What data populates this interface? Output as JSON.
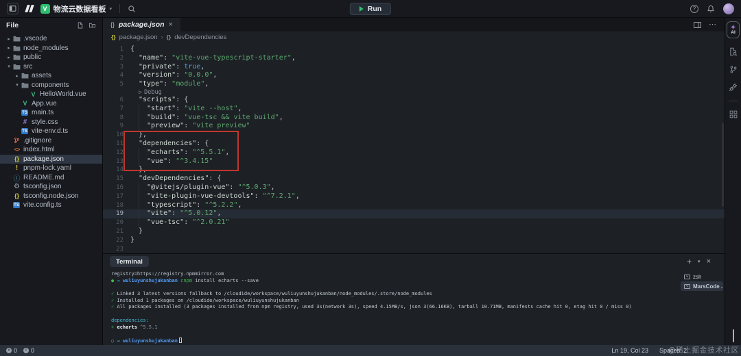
{
  "colors": {
    "accent_green": "#2fbf71",
    "annotation_red": "#c2362b",
    "ts_blue": "#3178c6",
    "json_yellow": "#cbcb41"
  },
  "titlebar": {
    "project_name": "物流云数据看板",
    "run_label": "Run"
  },
  "explorer": {
    "header": "File",
    "items": [
      {
        "depth": 0,
        "chevron": "closed",
        "icon": "folder",
        "label": ".vscode"
      },
      {
        "depth": 0,
        "chevron": "closed",
        "icon": "folder",
        "label": "node_modules"
      },
      {
        "depth": 0,
        "chevron": "closed",
        "icon": "folder",
        "label": "public"
      },
      {
        "depth": 0,
        "chevron": "open",
        "icon": "folder",
        "label": "src"
      },
      {
        "depth": 1,
        "chevron": "closed",
        "icon": "folder",
        "label": "assets"
      },
      {
        "depth": 1,
        "chevron": "open",
        "icon": "folder",
        "label": "components"
      },
      {
        "depth": 2,
        "icon": "vue",
        "label": "HelloWorld.vue"
      },
      {
        "depth": 1,
        "icon": "vue",
        "label": "App.vue"
      },
      {
        "depth": 1,
        "icon": "ts",
        "label": "main.ts"
      },
      {
        "depth": 1,
        "icon": "css",
        "label": "style.css"
      },
      {
        "depth": 1,
        "icon": "ts",
        "label": "vite-env.d.ts"
      },
      {
        "depth": 0,
        "icon": "git",
        "label": ".gitignore"
      },
      {
        "depth": 0,
        "icon": "html",
        "label": "index.html"
      },
      {
        "depth": 0,
        "icon": "json",
        "label": "package.json",
        "selected": true
      },
      {
        "depth": 0,
        "icon": "yaml",
        "label": "pnpm-lock.yaml"
      },
      {
        "depth": 0,
        "icon": "md",
        "label": "README.md"
      },
      {
        "depth": 0,
        "icon": "gear",
        "label": "tsconfig.json"
      },
      {
        "depth": 0,
        "icon": "json",
        "label": "tsconfig.node.json"
      },
      {
        "depth": 0,
        "icon": "ts",
        "label": "vite.config.ts"
      }
    ]
  },
  "editor": {
    "tab_label": "package.json",
    "breadcrumb": {
      "file": "package.json",
      "symbol": "devDependencies"
    },
    "lines": [
      {
        "n": 1,
        "ind": 0,
        "t": [
          [
            "p",
            "{"
          ]
        ]
      },
      {
        "n": 2,
        "ind": 1,
        "t": [
          [
            "k",
            "\"name\""
          ],
          [
            "p",
            ": "
          ],
          [
            "s",
            "\"vite-vue-typescript-starter\""
          ],
          [
            "p",
            ","
          ]
        ]
      },
      {
        "n": 3,
        "ind": 1,
        "t": [
          [
            "k",
            "\"private\""
          ],
          [
            "p",
            ": "
          ],
          [
            "b",
            "true"
          ],
          [
            "p",
            ","
          ]
        ]
      },
      {
        "n": 4,
        "ind": 1,
        "t": [
          [
            "k",
            "\"version\""
          ],
          [
            "p",
            ": "
          ],
          [
            "s",
            "\"0.0.0\""
          ],
          [
            "p",
            ","
          ]
        ]
      },
      {
        "n": 5,
        "ind": 1,
        "t": [
          [
            "k",
            "\"type\""
          ],
          [
            "p",
            ": "
          ],
          [
            "s",
            "\"module\""
          ],
          [
            "p",
            ","
          ]
        ]
      },
      {
        "lens": "Debug"
      },
      {
        "n": 6,
        "ind": 1,
        "t": [
          [
            "k",
            "\"scripts\""
          ],
          [
            "p",
            ": {"
          ]
        ]
      },
      {
        "n": 7,
        "ind": 2,
        "t": [
          [
            "k",
            "\"start\""
          ],
          [
            "p",
            ": "
          ],
          [
            "s",
            "\"vite --host\""
          ],
          [
            "p",
            ","
          ]
        ]
      },
      {
        "n": 8,
        "ind": 2,
        "t": [
          [
            "k",
            "\"build\""
          ],
          [
            "p",
            ": "
          ],
          [
            "s",
            "\"vue-tsc && vite build\""
          ],
          [
            "p",
            ","
          ]
        ]
      },
      {
        "n": 9,
        "ind": 2,
        "t": [
          [
            "k",
            "\"preview\""
          ],
          [
            "p",
            ": "
          ],
          [
            "s",
            "\"vite preview\""
          ]
        ]
      },
      {
        "n": 10,
        "ind": 1,
        "t": [
          [
            "p",
            "},"
          ]
        ]
      },
      {
        "n": 11,
        "ind": 1,
        "t": [
          [
            "k",
            "\"dependencies\""
          ],
          [
            "p",
            ": {"
          ]
        ]
      },
      {
        "n": 12,
        "ind": 2,
        "t": [
          [
            "k",
            "\"echarts\""
          ],
          [
            "p",
            ": "
          ],
          [
            "s",
            "\"^5.5.1\""
          ],
          [
            "p",
            ","
          ]
        ]
      },
      {
        "n": 13,
        "ind": 2,
        "t": [
          [
            "k",
            "\"vue\""
          ],
          [
            "p",
            ": "
          ],
          [
            "s",
            "\"^3.4.15\""
          ]
        ]
      },
      {
        "n": 14,
        "ind": 1,
        "t": [
          [
            "p",
            "},"
          ]
        ]
      },
      {
        "n": 15,
        "ind": 1,
        "t": [
          [
            "k",
            "\"devDependencies\""
          ],
          [
            "p",
            ": {"
          ]
        ]
      },
      {
        "n": 16,
        "ind": 2,
        "t": [
          [
            "k",
            "\"@vitejs/plugin-vue\""
          ],
          [
            "p",
            ": "
          ],
          [
            "s",
            "\"^5.0.3\""
          ],
          [
            "p",
            ","
          ]
        ]
      },
      {
        "n": 17,
        "ind": 2,
        "t": [
          [
            "k",
            "\"vite-plugin-vue-devtools\""
          ],
          [
            "p",
            ": "
          ],
          [
            "s",
            "\"^7.2.1\""
          ],
          [
            "p",
            ","
          ]
        ]
      },
      {
        "n": 18,
        "ind": 2,
        "t": [
          [
            "k",
            "\"typescript\""
          ],
          [
            "p",
            ": "
          ],
          [
            "s",
            "\"^5.2.2\""
          ],
          [
            "p",
            ","
          ]
        ]
      },
      {
        "n": 19,
        "ind": 2,
        "current": true,
        "t": [
          [
            "k",
            "\"vite\""
          ],
          [
            "p",
            ": "
          ],
          [
            "s",
            "\"^5.0.12\""
          ],
          [
            "p",
            ","
          ]
        ]
      },
      {
        "n": 20,
        "ind": 2,
        "t": [
          [
            "k",
            "\"vue-tsc\""
          ],
          [
            "p",
            ": "
          ],
          [
            "s",
            "\"^2.0.21\""
          ]
        ]
      },
      {
        "n": 21,
        "ind": 1,
        "t": [
          [
            "p",
            "}"
          ]
        ]
      },
      {
        "n": 22,
        "ind": 0,
        "t": [
          [
            "p",
            "}"
          ]
        ]
      },
      {
        "n": 23,
        "ind": 0,
        "t": []
      }
    ]
  },
  "terminal": {
    "tab_label": "Terminal",
    "sessions": [
      {
        "label": "zsh"
      },
      {
        "label": "MarsCode ...",
        "selected": true
      }
    ],
    "lines": [
      {
        "t": [
          [
            "x",
            "registry=https://registry.npmmirror.com"
          ]
        ]
      },
      {
        "t": [
          [
            "dot",
            "●"
          ],
          [
            "arr",
            " → "
          ],
          [
            "host",
            "wuliuyunshujukanban"
          ],
          [
            "g",
            " cnpm"
          ],
          [
            "x",
            " install echarts --save"
          ]
        ]
      },
      {
        "t": []
      },
      {
        "t": [
          [
            "g",
            "✓ "
          ],
          [
            "x",
            "Linked 3 latest versions fallback to /cloudide/workspace/wuliuyunshujukanban/node_modules/.store/node_modules"
          ]
        ]
      },
      {
        "t": [
          [
            "g",
            "✓ "
          ],
          [
            "x",
            "Installed 1 packages on /cloudide/workspace/wuliuyunshujukanban"
          ]
        ]
      },
      {
        "t": [
          [
            "g",
            "✓ "
          ],
          [
            "x",
            "All packages installed (3 packages installed from npm registry, used 3s(network 3s), speed 4.15MB/s, json 3(66.16KB), tarball 10.71MB, manifests cache hit 0, etag hit 0 / miss 0)"
          ]
        ]
      },
      {
        "t": []
      },
      {
        "t": [
          [
            "cy",
            "dependencies:"
          ]
        ]
      },
      {
        "t": [
          [
            "g",
            "+ "
          ],
          [
            "w",
            "echarts"
          ],
          [
            "dim",
            " ^5.5.1"
          ]
        ]
      },
      {
        "t": []
      },
      {
        "t": [
          [
            "odot",
            "○"
          ],
          [
            "arr",
            " → "
          ],
          [
            "host",
            "wuliuyunshujukanban"
          ],
          [
            "cur",
            ""
          ]
        ]
      }
    ]
  },
  "rightbar": {
    "ai_label": "AI"
  },
  "statusbar": {
    "errors": "0",
    "warnings": "0",
    "cursor": "Ln 19, Col 23",
    "indent": "Spaces: 2"
  },
  "watermark": "@稀土掘金技术社区"
}
